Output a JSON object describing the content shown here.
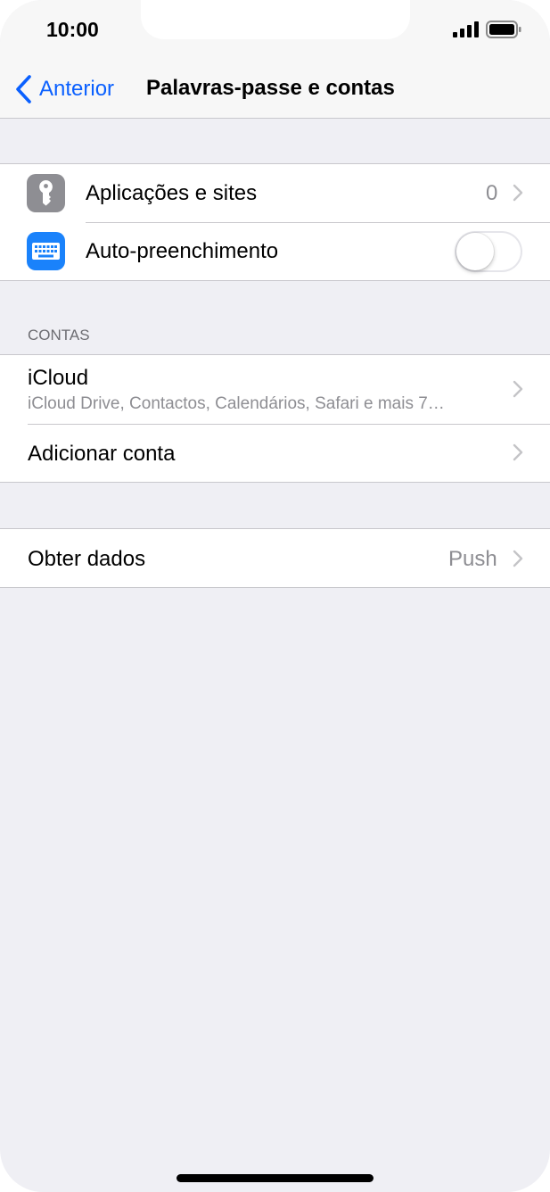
{
  "status_bar": {
    "time": "10:00"
  },
  "nav": {
    "back_label": "Anterior",
    "title": "Palavras-passe e contas"
  },
  "group1": {
    "apps_sites": {
      "label": "Aplicações e sites",
      "count": "0"
    },
    "autofill": {
      "label": "Auto-preenchimento",
      "enabled": false
    }
  },
  "accounts": {
    "header": "CONTAS",
    "icloud": {
      "title": "iCloud",
      "subtitle": "iCloud Drive, Contactos, Calendários, Safari e mais 7…"
    },
    "add_account": {
      "label": "Adicionar conta"
    }
  },
  "fetch": {
    "label": "Obter dados",
    "value": "Push"
  },
  "colors": {
    "accent": "#0a60ff",
    "background": "#efeff4",
    "separator": "#c8c7cc",
    "icon_gray": "#8e8e93",
    "icon_blue": "#1a82fb"
  },
  "icons": [
    "key-icon",
    "keyboard-icon",
    "chevron-right-icon",
    "back-chevron-icon"
  ]
}
